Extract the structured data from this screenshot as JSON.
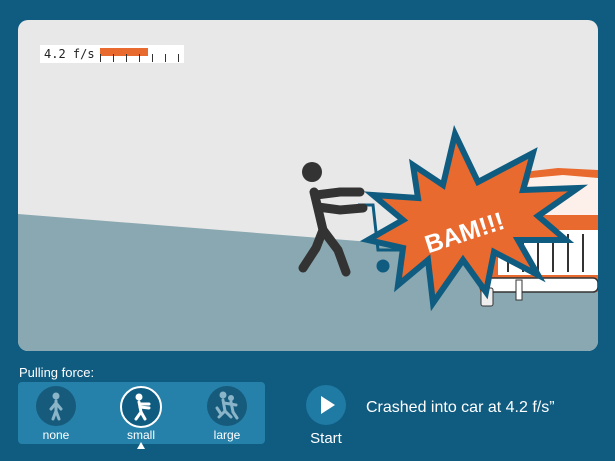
{
  "speedometer": {
    "text": "4.2 f/s",
    "level_fraction": 0.6
  },
  "scene": {
    "impact_text": "BAM!!!",
    "colors": {
      "sky": "#e8e8e8",
      "ground": "#8aa8b1",
      "car": "#e96a2e",
      "burst": "#e96a2e",
      "burst_outline": "#0f5c80",
      "person": "#333333"
    }
  },
  "controls": {
    "force_label": "Pulling force:",
    "options": [
      {
        "label": "none",
        "icon": "standing-person-icon"
      },
      {
        "label": "small",
        "icon": "pulling-person-icon"
      },
      {
        "label": "large",
        "icon": "group-pulling-icon"
      }
    ],
    "selected_option": "small",
    "start_label": "Start",
    "start_icon": "play-icon",
    "status": "Crashed into car at 4.2 f/s”"
  }
}
